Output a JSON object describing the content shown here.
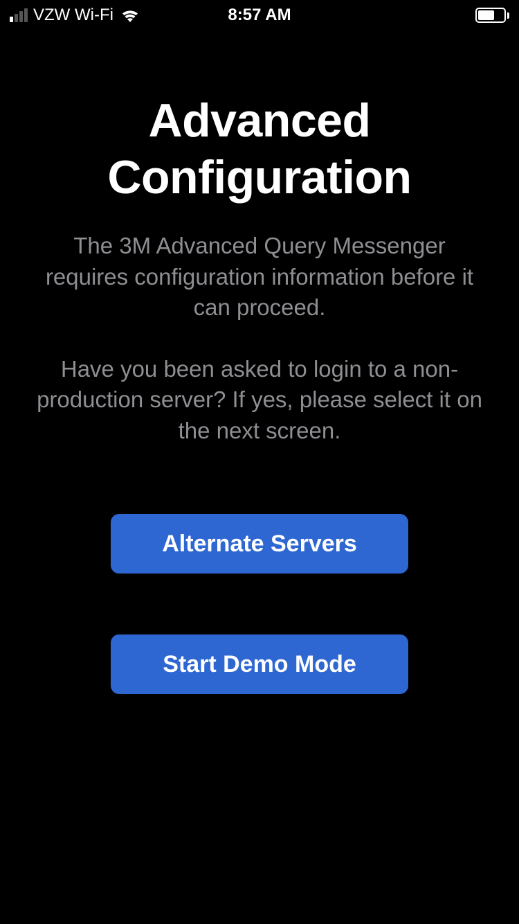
{
  "statusBar": {
    "carrier": "VZW Wi-Fi",
    "time": "8:57 AM"
  },
  "page": {
    "title": "Advanced Configuration",
    "description1": "The 3M Advanced Query Messenger requires configuration information before it can proceed.",
    "description2": "Have you been asked to login to a non-production server? If yes, please select it on the next screen."
  },
  "buttons": {
    "alternateServers": "Alternate Servers",
    "startDemoMode": "Start Demo Mode"
  },
  "colors": {
    "background": "#000000",
    "buttonPrimary": "#2e67d1",
    "textPrimary": "#ffffff",
    "textSecondary": "#8e8e93"
  }
}
